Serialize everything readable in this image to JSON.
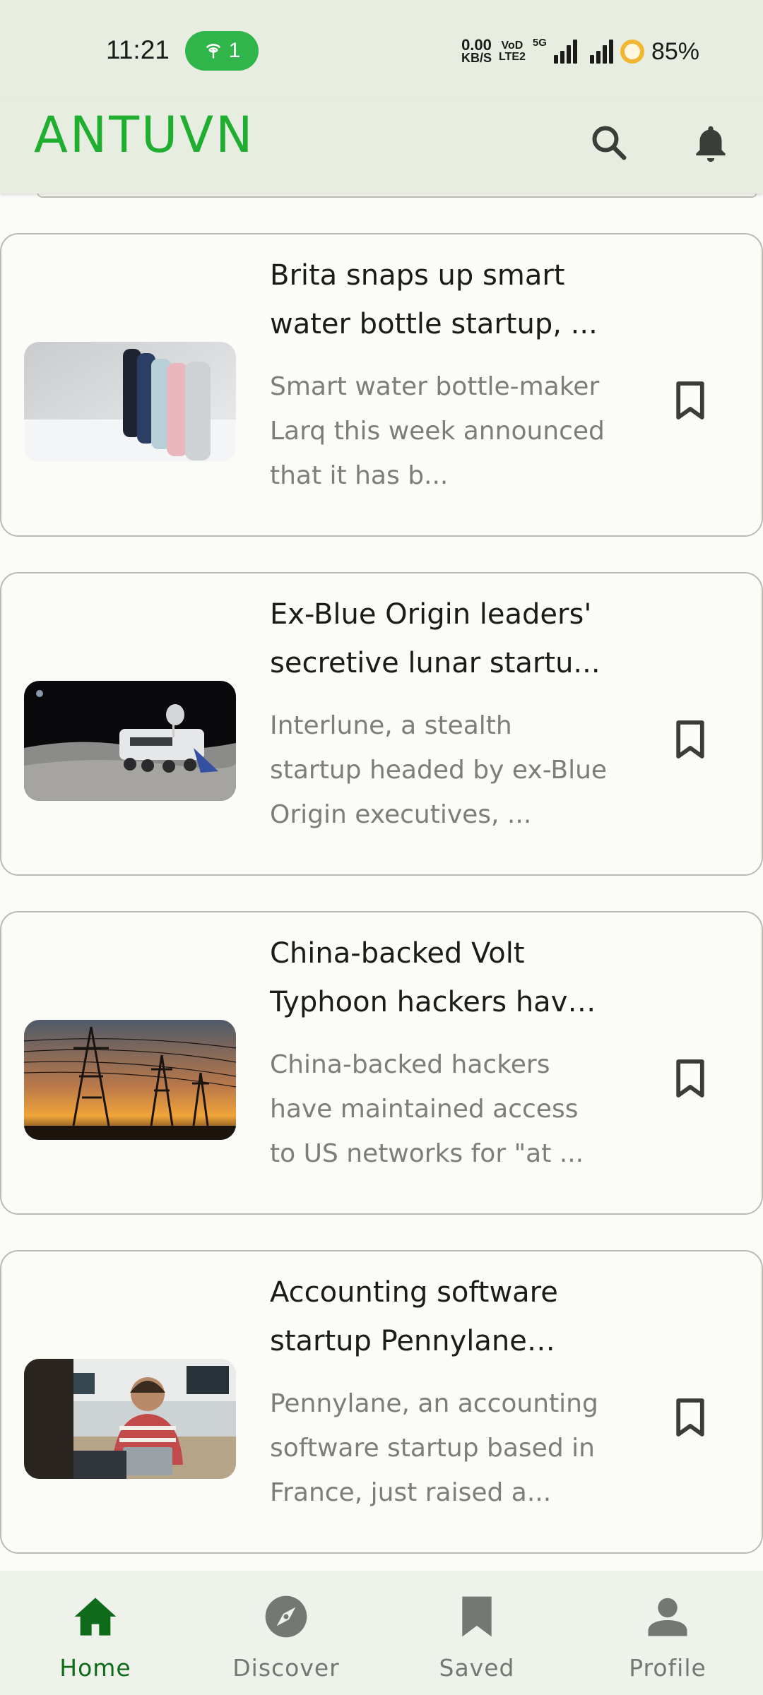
{
  "status_bar": {
    "time": "11:21",
    "hotspot_count": "1",
    "net_speed_value": "0.00",
    "net_speed_unit": "KB/S",
    "volte_top": "VoD",
    "volte_bottom": "LTE2",
    "network_type": "5G",
    "battery": "85%"
  },
  "app_bar": {
    "title": "ANTUVN",
    "title_color": "#1fae2f",
    "actions": [
      "search-icon",
      "bell-icon"
    ]
  },
  "articles": [
    {
      "title": "Brita snaps up smart water bottle startup, ...",
      "summary": "Smart water bottle-maker Larq this week announced that it has b...",
      "thumbnail": "water-bottles-image"
    },
    {
      "title": "Ex-Blue Origin leaders' secretive lunar startu...",
      "summary": "Interlune, a stealth startup headed by ex-Blue Origin executives, ...",
      "thumbnail": "lunar-rover-image"
    },
    {
      "title": "China-backed Volt Typhoon hackers have ...",
      "summary": "China-backed hackers have maintained access to US networks for \"at ...",
      "thumbnail": "power-lines-sunset-image"
    },
    {
      "title": "Accounting software startup Pennylane bec...",
      "summary": "Pennylane, an accounting software startup based in France, just raised a...",
      "thumbnail": "office-workers-image"
    }
  ],
  "bottom_nav": {
    "items": [
      {
        "label": "Home",
        "icon": "home-icon",
        "active": true
      },
      {
        "label": "Discover",
        "icon": "compass-icon",
        "active": false
      },
      {
        "label": "Saved",
        "icon": "bookmark-icon",
        "active": false
      },
      {
        "label": "Profile",
        "icon": "person-icon",
        "active": false
      }
    ],
    "active_color": "#0e6b1a",
    "inactive_color": "#757772"
  }
}
